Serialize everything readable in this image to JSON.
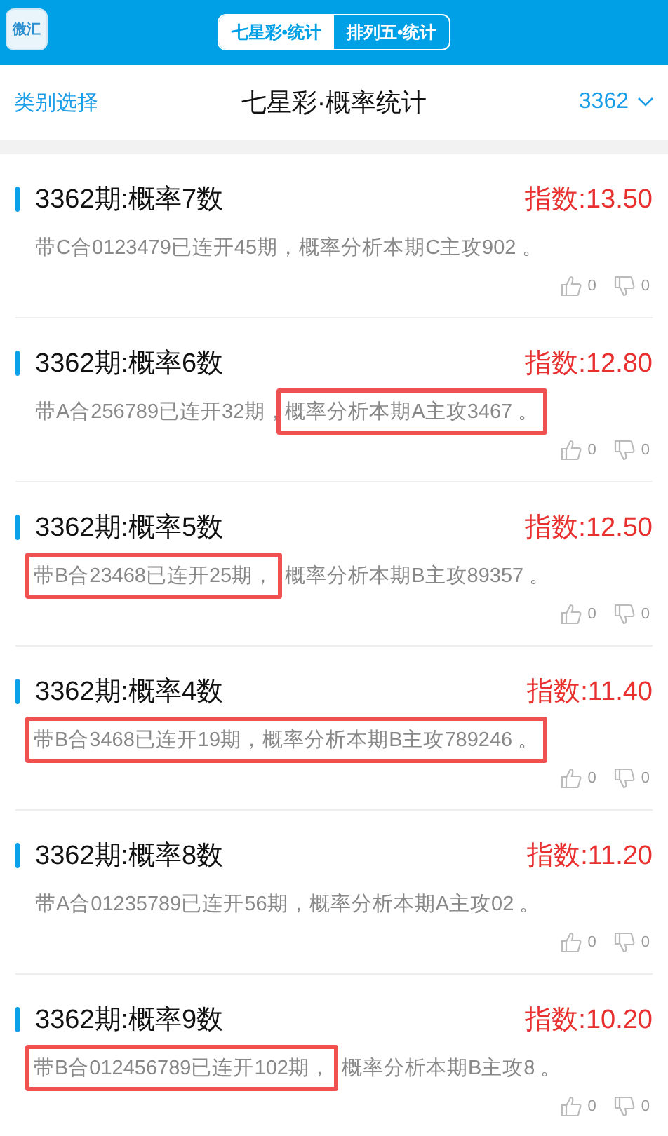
{
  "header": {
    "logo": "微汇",
    "tabs": [
      {
        "label": "七星彩•统计",
        "selected": true
      },
      {
        "label": "排列五•统计",
        "selected": false
      }
    ]
  },
  "subheader": {
    "left": "类别选择",
    "title": "七星彩·概率统计",
    "period": "3362"
  },
  "items": [
    {
      "title": "3362期:概率7数",
      "index": "指数:13.50",
      "streak": "带C合0123479已连开45期，",
      "forecast": "概率分析本期C主攻902 。",
      "streak_highlighted": false,
      "forecast_highlighted": false,
      "likes": "0",
      "dislikes": "0"
    },
    {
      "title": "3362期:概率6数",
      "index": "指数:12.80",
      "streak": "带A合256789已连开32期，",
      "forecast": "概率分析本期A主攻3467 。",
      "streak_highlighted": false,
      "forecast_highlighted": true,
      "likes": "0",
      "dislikes": "0"
    },
    {
      "title": "3362期:概率5数",
      "index": "指数:12.50",
      "streak": "带B合23468已连开25期，",
      "forecast": "概率分析本期B主攻89357 。",
      "streak_highlighted": true,
      "forecast_highlighted": false,
      "likes": "0",
      "dislikes": "0"
    },
    {
      "title": "3362期:概率4数",
      "index": "指数:11.40",
      "streak": "带B合3468已连开19期，",
      "forecast": "概率分析本期B主攻789246 。",
      "streak_highlighted": true,
      "forecast_highlighted": true,
      "likes": "0",
      "dislikes": "0"
    },
    {
      "title": "3362期:概率8数",
      "index": "指数:11.20",
      "streak": "带A合01235789已连开56期，",
      "forecast": "概率分析本期A主攻02 。",
      "streak_highlighted": false,
      "forecast_highlighted": false,
      "likes": "0",
      "dislikes": "0"
    },
    {
      "title": "3362期:概率9数",
      "index": "指数:10.20",
      "streak": "带B合012456789已连开102期，",
      "forecast": "概率分析本期B主攻8 。",
      "streak_highlighted": true,
      "forecast_highlighted": false,
      "likes": "0",
      "dislikes": "0"
    }
  ]
}
